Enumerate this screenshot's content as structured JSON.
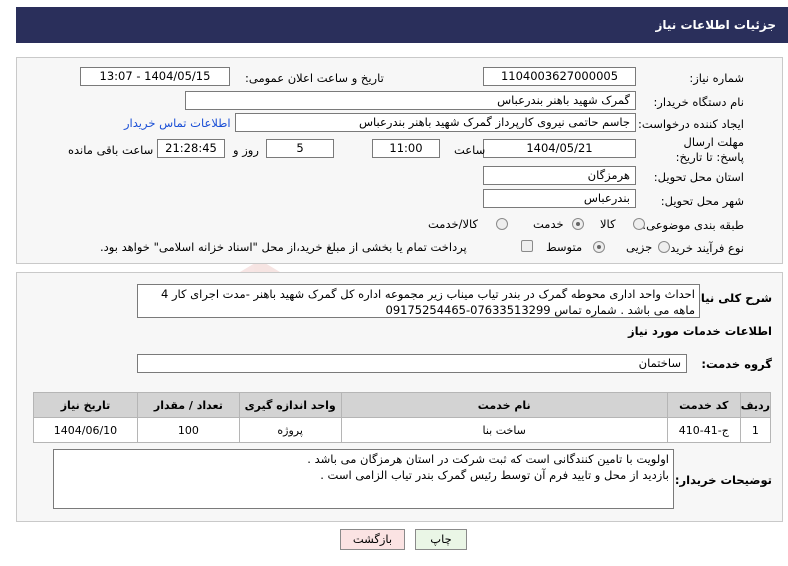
{
  "header": {
    "title": "جزئیات اطلاعات نیاز"
  },
  "form": {
    "need_number_label": "شماره نیاز:",
    "need_number": "1104003627000005",
    "announce_label": "تاریخ و ساعت اعلان عمومی:",
    "announce_value": "1404/05/15 - 13:07",
    "buyer_org_label": "نام دستگاه خریدار:",
    "buyer_org": "گمرک شهید باهنر بندرعباس",
    "requester_label": "ایجاد کننده درخواست:",
    "requester": "جاسم حاتمی نیروی کارپرداز گمرک شهید باهنر بندرعباس",
    "contact_link": "اطلاعات تماس خریدار",
    "deadline_label": "مهلت ارسال پاسخ: تا تاریخ:",
    "deadline_date": "1404/05/21",
    "time_label": "ساعت",
    "deadline_time": "11:00",
    "days_value": "5",
    "days_label": "روز و",
    "remaining_value": "21:28:45",
    "remaining_label": "ساعت باقی مانده",
    "province_label": "استان محل تحویل:",
    "province": "هرمزگان",
    "city_label": "شهر محل تحویل:",
    "city": "بندرعباس",
    "category_label": "طبقه بندی موضوعی:",
    "category_options": [
      "کالا",
      "خدمت",
      "کالا/خدمت"
    ],
    "category_selected": "خدمت",
    "process_label": "نوع فرآیند خرید :",
    "process_options": [
      "جزیی",
      "متوسط"
    ],
    "process_selected": "متوسط",
    "payment_note": "پرداخت تمام یا بخشی از مبلغ خرید،از محل \"اسناد خزانه اسلامی\" خواهد بود."
  },
  "summary": {
    "label": "شرح کلی نیاز:",
    "text": "احداث واحد اداری محوطه گمرک در بندر تیاب میناب زیر مجموعه اداره کل گمرک شهید باهنر -مدت اجرای کار 4 ماهه می باشد . شماره تماس 07633513299-09175254465"
  },
  "services": {
    "section_title": "اطلاعات خدمات مورد نیاز",
    "group_label": "گروه خدمت:",
    "group_value": "ساختمان",
    "columns": [
      "ردیف",
      "کد خدمت",
      "نام خدمت",
      "واحد اندازه گیری",
      "تعداد / مقدار",
      "تاریخ نیاز"
    ],
    "rows": [
      [
        "1",
        "ج-41-410",
        "ساخت بنا",
        "پروژه",
        "100",
        "1404/06/10"
      ]
    ]
  },
  "buyer_notes": {
    "label": "توضیحات خریدار:",
    "line1": "اولویت با تامین کنندگانی  است که ثبت شرکت در استان هرمزگان می باشد .",
    "line2": "بازدید از محل و تایید فرم آن توسط رئیس گمرک بندر تیاب الزامی است ."
  },
  "buttons": {
    "print": "چاپ",
    "back": "بازگشت"
  },
  "watermark": {
    "text": "AriaTender.neT"
  },
  "colors": {
    "title_bar": "#2a2f5b",
    "print_button": "#eaf6e6",
    "back_button": "#fbe3e3",
    "link": "#1a4fd6"
  }
}
